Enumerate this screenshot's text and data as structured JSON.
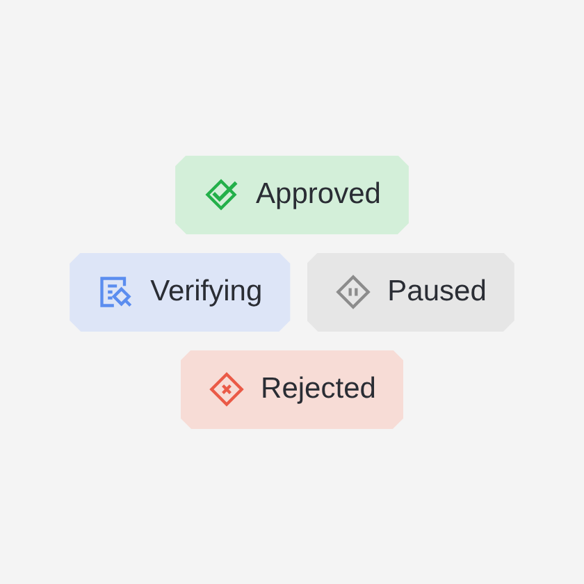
{
  "rows": [
    [
      {
        "kind": "approved",
        "label": "Approved",
        "color": "#23b04a"
      }
    ],
    [
      {
        "kind": "verifying",
        "label": "Verifying",
        "color": "#5b8def"
      },
      {
        "kind": "paused",
        "label": "Paused",
        "color": "#8c8c8c"
      }
    ],
    [
      {
        "kind": "rejected",
        "label": "Rejected",
        "color": "#ea5a47"
      }
    ]
  ]
}
